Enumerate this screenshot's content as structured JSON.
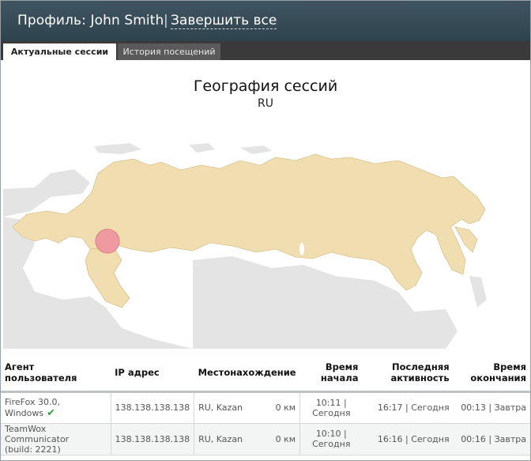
{
  "header": {
    "title": "Профиль: John Smith",
    "separator": "|",
    "logout_all": "Завершить все"
  },
  "tabs": [
    {
      "label": "Актуальные сессии",
      "active": true
    },
    {
      "label": "История посещений",
      "active": false
    }
  ],
  "map": {
    "title": "География сессий",
    "subtitle": "RU",
    "highlight_color": "#f0ddb0",
    "marker_color": "#ef9aa0"
  },
  "table": {
    "columns": {
      "agent": "Агент пользователя",
      "ip": "IP адрес",
      "location": "Местонахождение",
      "start_1": "Время",
      "start_2": "начала",
      "last_1": "Последняя",
      "last_2": "активность",
      "end_1": "Время",
      "end_2": "окончания"
    },
    "rows": [
      {
        "agent": "FireFox 30.0, Windows",
        "current": true,
        "ip": "138.138.138.138",
        "location": "RU, Kazan",
        "distance": "0 км",
        "start_time": "10:11 |",
        "start_day": "Сегодня",
        "last_activity": "16:17 | Сегодня",
        "end": "00:13 | Завтра"
      },
      {
        "agent_1": "TeamWox Communicator",
        "agent_2": "(build: 2221)",
        "current": false,
        "ip": "138.138.138.138",
        "location": "RU, Kazan",
        "distance": "0 км",
        "start_time": "10:10 |",
        "start_day": "Сегодня",
        "last_activity": "16:16 | Сегодня",
        "end": "00:16 | Завтра"
      }
    ]
  }
}
